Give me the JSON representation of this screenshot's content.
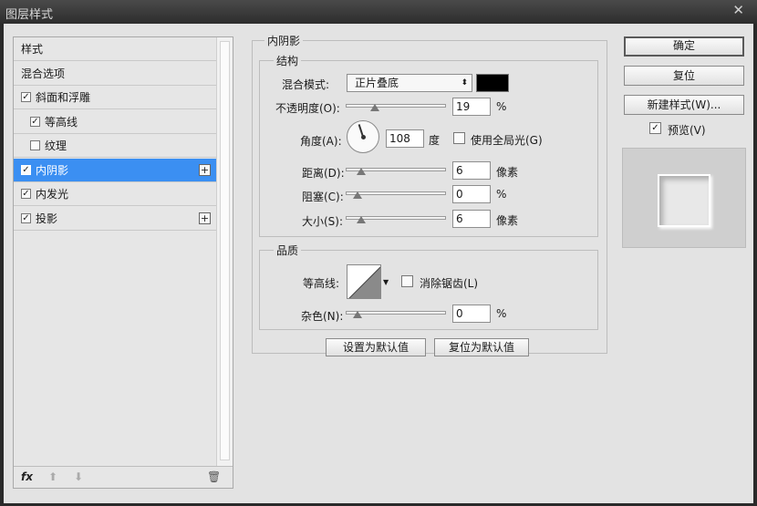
{
  "window": {
    "title": "图层样式",
    "close_label": "✕"
  },
  "sidebar": {
    "items": [
      {
        "label": "样式",
        "has_checkbox": false,
        "checked": false,
        "selected": false,
        "has_plus": false
      },
      {
        "label": "混合选项",
        "has_checkbox": false,
        "checked": false,
        "selected": false,
        "has_plus": false
      },
      {
        "label": "斜面和浮雕",
        "has_checkbox": true,
        "checked": true,
        "selected": false,
        "has_plus": false
      },
      {
        "label": "等高线",
        "has_checkbox": true,
        "checked": true,
        "selected": false,
        "has_plus": false
      },
      {
        "label": "纹理",
        "has_checkbox": true,
        "checked": false,
        "selected": false,
        "has_plus": false
      },
      {
        "label": "内阴影",
        "has_checkbox": true,
        "checked": true,
        "selected": true,
        "has_plus": true
      },
      {
        "label": "内发光",
        "has_checkbox": true,
        "checked": true,
        "selected": false,
        "has_plus": false
      },
      {
        "label": "投影",
        "has_checkbox": true,
        "checked": true,
        "selected": false,
        "has_plus": true
      }
    ],
    "plus_glyph": "+",
    "check_glyph": "✓",
    "bottom": {
      "fx_label": "fx",
      "up_glyph": "⬆",
      "down_glyph": "⬇",
      "trash_glyph": "🗑"
    }
  },
  "inner_shadow": {
    "group_title": "内阴影",
    "structure": {
      "title": "结构",
      "blend_mode_label": "混合模式:",
      "blend_mode_value": "正片叠底",
      "blend_mode_arrow": "⬍",
      "shadow_color": "#000000",
      "opacity_label": "不透明度(O):",
      "opacity_value": "19",
      "opacity_unit": "%",
      "opacity_level": 19,
      "angle_label": "角度(A):",
      "angle_value": "108",
      "angle_unit": "度",
      "global_light_label": "使用全局光(G)",
      "global_light_checked": false,
      "distance_label": "距离(D):",
      "distance_value": "6",
      "distance_unit": "像素",
      "distance_level": 4,
      "choke_label": "阻塞(C):",
      "choke_value": "0",
      "choke_unit": "%",
      "choke_level": 0,
      "size_label": "大小(S):",
      "size_value": "6",
      "size_unit": "像素",
      "size_level": 4
    },
    "quality": {
      "title": "品质",
      "contour_label": "等高线:",
      "antialias_label": "消除锯齿(L)",
      "antialias_checked": false,
      "noise_label": "杂色(N):",
      "noise_value": "0",
      "noise_unit": "%",
      "noise_level": 0
    },
    "make_default_label": "设置为默认值",
    "reset_default_label": "复位为默认值"
  },
  "actions": {
    "ok_label": "确定",
    "reset_label": "复位",
    "new_style_label": "新建样式(W)...",
    "preview_label": "预览(V)",
    "preview_checked": true
  }
}
